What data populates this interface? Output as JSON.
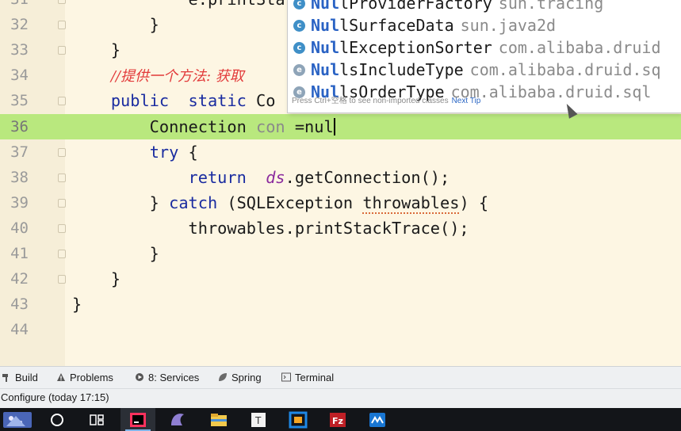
{
  "editor": {
    "lines": [
      {
        "num": "31",
        "tokens": [
          {
            "t": "            e.printSta",
            "c": ""
          }
        ]
      },
      {
        "num": "32",
        "tokens": [
          {
            "t": "        }",
            "c": ""
          }
        ]
      },
      {
        "num": "33",
        "tokens": [
          {
            "t": "    }",
            "c": ""
          }
        ]
      },
      {
        "num": "34",
        "tokens": [
          {
            "t": "    ",
            "c": ""
          },
          {
            "t": "//提供一个方法: 获取",
            "c": "cmt"
          }
        ]
      },
      {
        "num": "35",
        "tokens": [
          {
            "t": "    ",
            "c": ""
          },
          {
            "t": "public",
            "c": "kw"
          },
          {
            "t": "  ",
            "c": ""
          },
          {
            "t": "static",
            "c": "kw"
          },
          {
            "t": " Co",
            "c": ""
          }
        ]
      },
      {
        "num": "36",
        "tokens": [
          {
            "t": "        Connection ",
            "c": ""
          },
          {
            "t": "con",
            "c": "gry"
          },
          {
            "t": " =nul",
            "c": ""
          }
        ]
      },
      {
        "num": "37",
        "tokens": [
          {
            "t": "        ",
            "c": ""
          },
          {
            "t": "try",
            "c": "kw"
          },
          {
            "t": " {",
            "c": ""
          }
        ]
      },
      {
        "num": "38",
        "tokens": [
          {
            "t": "            ",
            "c": ""
          },
          {
            "t": "return",
            "c": "kw"
          },
          {
            "t": "  ",
            "c": ""
          },
          {
            "t": "ds",
            "c": "fld"
          },
          {
            "t": ".getConnection();",
            "c": ""
          }
        ]
      },
      {
        "num": "39",
        "tokens": [
          {
            "t": "        } ",
            "c": ""
          },
          {
            "t": "catch",
            "c": "kw"
          },
          {
            "t": " (SQLException ",
            "c": ""
          },
          {
            "t": "throwables",
            "c": "squiggle"
          },
          {
            "t": ") {",
            "c": ""
          }
        ]
      },
      {
        "num": "40",
        "tokens": [
          {
            "t": "            throwables.printStackTrace();",
            "c": ""
          }
        ]
      },
      {
        "num": "41",
        "tokens": [
          {
            "t": "        }",
            "c": ""
          }
        ]
      },
      {
        "num": "42",
        "tokens": [
          {
            "t": "    }",
            "c": ""
          }
        ]
      },
      {
        "num": "43",
        "tokens": [
          {
            "t": "}",
            "c": ""
          }
        ]
      },
      {
        "num": "44",
        "tokens": []
      }
    ],
    "current_line": "36"
  },
  "completion": {
    "items": [
      {
        "icon": "c",
        "match": "Nul",
        "rest": "lProviderFactory",
        "pkg": "sun.tracing"
      },
      {
        "icon": "c",
        "match": "Nul",
        "rest": "lSurfaceData",
        "pkg": "sun.java2d"
      },
      {
        "icon": "c",
        "match": "Nul",
        "rest": "lExceptionSorter",
        "pkg": "com.alibaba.druid"
      },
      {
        "icon": "e",
        "match": "Nul",
        "rest": "lsIncludeType",
        "pkg": "com.alibaba.druid.sq"
      },
      {
        "icon": "e",
        "match": "Nul",
        "rest": "lsOrderType",
        "pkg": "com.alibaba.druid.sql"
      }
    ],
    "footer_text": "Press Ctrl+空格 to see non-imported classes",
    "next_tip": "Next Tip"
  },
  "toolwindows": {
    "build": "Build",
    "problems": "Problems",
    "services": "8: Services",
    "spring": "Spring",
    "terminal": "Terminal"
  },
  "statusbar": {
    "text": "Configure (today 17:15)"
  },
  "colors": {
    "editor_bg": "#fdf6e3",
    "current_line": "#b9e87e",
    "keyword": "#1a2ca0",
    "comment": "#e23a3a",
    "field": "#8b2b9e",
    "completion_match": "#2962c4"
  },
  "taskbar": {
    "apps": [
      "start-menu-icon",
      "search-icon",
      "task-view-icon",
      "intellij-idea-icon",
      "mysql-workbench-icon",
      "file-explorer-icon",
      "typora-icon",
      "virtualbox-icon",
      "filezilla-icon",
      "xshell-icon"
    ]
  }
}
